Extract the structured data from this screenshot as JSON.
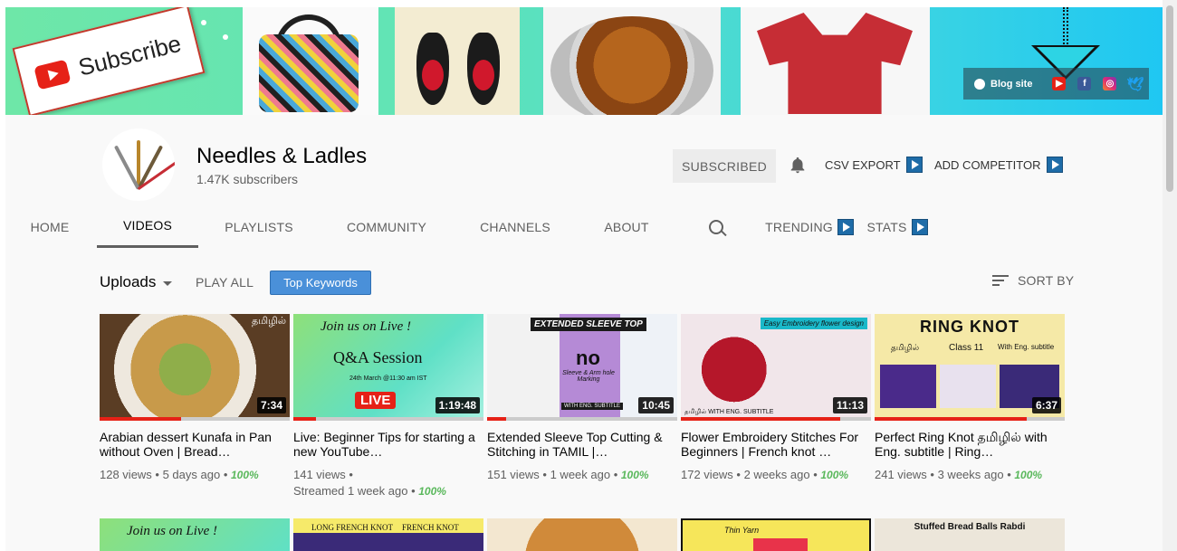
{
  "banner": {
    "subscribe_text": "Subscribe",
    "links": {
      "blog_label": "Blog site"
    }
  },
  "channel": {
    "name": "Needles & Ladles",
    "subscribers": "1.47K subscribers",
    "subscribed_label": "SUBSCRIBED",
    "csv_export_label": "CSV EXPORT",
    "add_competitor_label": "ADD COMPETITOR",
    "avatar_text": "Needle And Ladle"
  },
  "tabs": [
    "HOME",
    "VIDEOS",
    "PLAYLISTS",
    "COMMUNITY",
    "CHANNELS",
    "ABOUT",
    "TRENDING",
    "STATS"
  ],
  "toolbar": {
    "uploads_label": "Uploads",
    "play_all_label": "PLAY ALL",
    "top_keywords_label": "Top Keywords",
    "sort_by_label": "SORT BY"
  },
  "videos": [
    {
      "title": "Arabian dessert Kunafa in Pan without Oven | Bread…",
      "views": "128 views",
      "age": "5 days ago",
      "percent": "100%",
      "duration": "7:34",
      "progress": 0.43,
      "tag": "தமிழில்"
    },
    {
      "title": "Live: Beginner Tips for starting a new YouTube…",
      "views": "141 views",
      "age": "Streamed 1 week ago",
      "percent": "100%",
      "duration": "1:19:48",
      "progress": 0.12,
      "banner_text": "Join us on Live !",
      "qa_text": "Q&A Session",
      "date_text": "24th March @11:30 am IST",
      "live_text": "LIVE"
    },
    {
      "title": "Extended Sleeve Top Cutting & Stitching in TAMIL |…",
      "views": "151 views",
      "age": "1 week ago",
      "percent": "100%",
      "duration": "10:45",
      "progress": 0.1,
      "top_text": "EXTENDED SLEEVE TOP",
      "no_text": "no",
      "sub_text": "Sleeve & Arm hole Marking",
      "eng_text": "WITH ENG. SUBTITLE"
    },
    {
      "title": "Flower Embroidery Stitches For Beginners | French knot …",
      "views": "172 views",
      "age": "2 weeks ago",
      "percent": "100%",
      "duration": "11:13",
      "progress": 0.84,
      "top_text": "Easy Embroidery flower design",
      "bottom_text": "தமிழில் WITH ENG. SUBTITLE"
    },
    {
      "title": "Perfect Ring Knot தமிழில் with Eng. subtitle | Ring…",
      "views": "241 views",
      "age": "3 weeks ago",
      "percent": "100%",
      "duration": "6:37",
      "progress": 0.8,
      "heading": "RING KNOT",
      "tamil": "தமிழில்",
      "class_text": "Class 11",
      "sub_text": "With Eng. subtitle"
    }
  ],
  "row2": [
    {
      "text": "Join us on Live !"
    },
    {
      "text_left": "LONG FRENCH KNOT",
      "text_right": "FRENCH KNOT"
    },
    {
      "text": ""
    },
    {
      "text": "Thin Yarn"
    },
    {
      "text": "Stuffed Bread Balls Rabdi"
    }
  ],
  "colors": {
    "accent": "#e62117",
    "keyword_button": "#4a90d9",
    "percent": "#5ab85c"
  }
}
